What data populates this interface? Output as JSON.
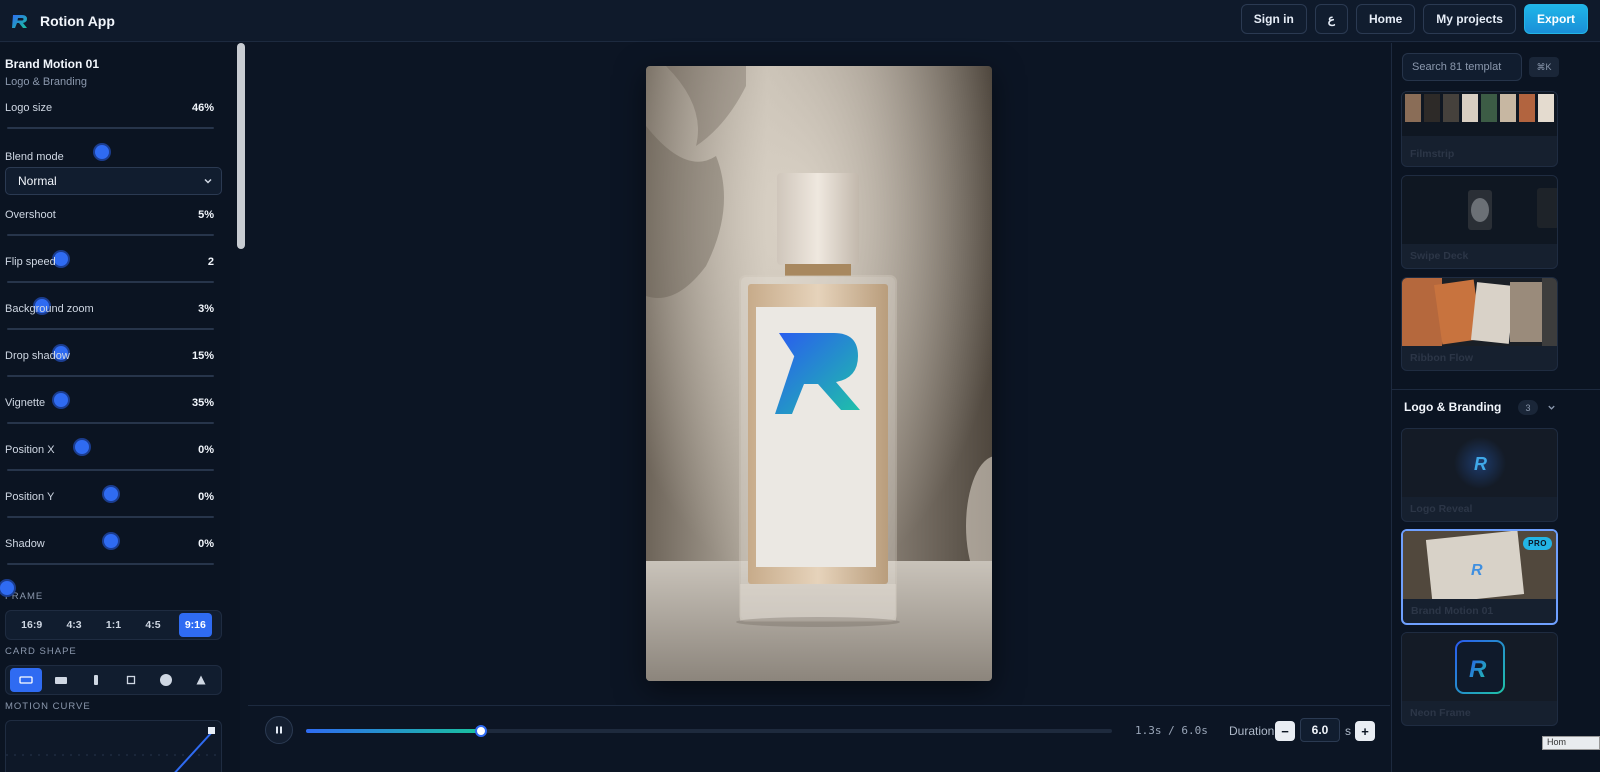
{
  "app": {
    "title": "Rotion App"
  },
  "header": {
    "sign_in": "Sign in",
    "lang": "ع",
    "home": "Home",
    "my_projects": "My projects",
    "export": "Export"
  },
  "project": {
    "title": "Brand Motion 01",
    "subtitle": "Logo & Branding"
  },
  "controls": {
    "logo_size": {
      "label": "Logo size",
      "value": "46%",
      "level": 0.46
    },
    "blend_mode": {
      "label": "Blend mode",
      "selected": "Normal"
    },
    "overshoot": {
      "label": "Overshoot",
      "value": "5%",
      "level": 0.26
    },
    "flip_speed": {
      "label": "Flip speed",
      "value": "2",
      "level": 0.17
    },
    "background_zoom": {
      "label": "Background zoom",
      "value": "3%",
      "level": 0.26
    },
    "drop_shadow": {
      "label": "Drop shadow",
      "value": "15%",
      "level": 0.26
    },
    "vignette": {
      "label": "Vignette",
      "value": "35%",
      "level": 0.36
    },
    "position_x": {
      "label": "Position X",
      "value": "0%",
      "level": 0.5
    },
    "position_y": {
      "label": "Position Y",
      "value": "0%",
      "level": 0.5
    },
    "shadow": {
      "label": "Shadow",
      "value": "0%",
      "level": 0.0
    }
  },
  "frame": {
    "heading": "FRAME",
    "options": [
      "16:9",
      "4:3",
      "1:1",
      "4:5",
      "9:16"
    ],
    "selected": "9:16"
  },
  "card_shape": {
    "heading": "CARD SHAPE",
    "options": [
      "rect-wide-icon",
      "rect-filled-icon",
      "bar-icon",
      "square-icon",
      "circle-icon",
      "triangle-icon"
    ],
    "selected": "rect-wide-icon"
  },
  "motion_curve": {
    "heading": "MOTION CURVE"
  },
  "timeline": {
    "timecode": "1.3s / 6.0s",
    "progress": 0.2167,
    "duration_label": "Duration",
    "duration_value": "6.0",
    "unit": "s",
    "minus": "−",
    "plus": "+"
  },
  "templates": {
    "search_placeholder": "Search 81 templat",
    "shortcut": "⌘K",
    "items": [
      {
        "name": "Filmstrip"
      },
      {
        "name": "Swipe Deck"
      },
      {
        "name": "Ribbon Flow"
      }
    ],
    "category": {
      "name": "Logo & Branding",
      "count": "3"
    },
    "category_items": [
      {
        "name": "Logo Reveal"
      },
      {
        "name": "Brand Motion 01",
        "badge": "PRO"
      },
      {
        "name": "Neon Frame"
      }
    ]
  },
  "tooltip": {
    "text": "Hom"
  },
  "colors": {
    "accent": "#2f6bf2",
    "export": "#1fb6e8",
    "teal": "#19c29e"
  }
}
